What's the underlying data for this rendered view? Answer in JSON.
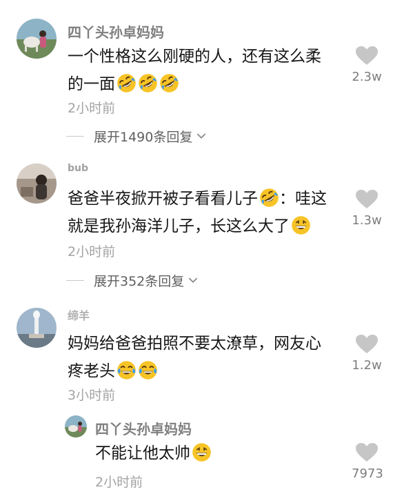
{
  "comments": [
    {
      "username": "四丫头孙卓妈妈",
      "line1": "一个性格这么刚硬的人，还有这么柔",
      "line2": "的一面",
      "emoji_icons": [
        "rofl-icon",
        "rofl-icon",
        "rofl-icon"
      ],
      "time": "2小时前",
      "likes": "2.3w",
      "expand_label": "展开1490条回复"
    },
    {
      "username": "bub",
      "line1": "爸爸半夜掀开被子看看儿子",
      "line1_emoji": "rofl-icon",
      "line1_tail": "：哇这",
      "line2": "就是我孙海洋儿子，长这么大了",
      "line2_emoji": "grin-icon",
      "time": "2小时前",
      "likes": "1.3w",
      "expand_label": "展开352条回复"
    },
    {
      "username": "缔羊",
      "line1": "妈妈给爸爸拍照不要太潦草，网友心",
      "line2": "疼老头",
      "emoji_icons": [
        "tears-of-joy-icon",
        "tears-of-joy-icon"
      ],
      "time": "3小时前",
      "likes": "1.2w"
    }
  ],
  "reply": {
    "username": "四丫头孙卓妈妈",
    "text": "不能让他太帅",
    "emoji": "grin-icon",
    "time": "2小时前",
    "likes": "7973"
  },
  "colors": {
    "username": "#7f7f7f",
    "text": "#161616",
    "time": "#a3a3a3",
    "heart": "#c6c6c6"
  }
}
